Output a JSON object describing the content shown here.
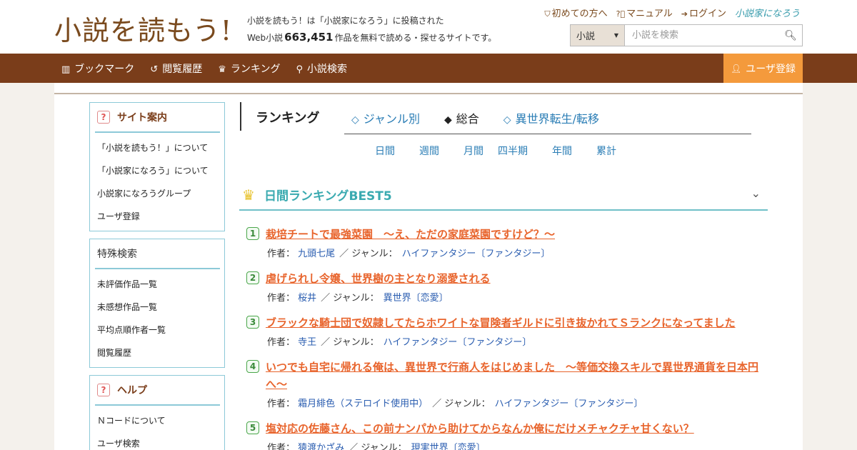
{
  "header": {
    "logo_text": "小説を読もう!",
    "tagline_line1": "小説を読もう！は「小説家になろう」に投稿された",
    "tagline_prefix": "Web小説",
    "work_count": "663,451",
    "tagline_suffix": "作品を無料で読める・探せるサイトです。",
    "toplinks": {
      "first_time": "初めての方へ",
      "manual": "マニュアル",
      "login": "ログイン",
      "narou_logo": "小説家になろう"
    },
    "search": {
      "category": "小説",
      "placeholder": "小説を検索"
    }
  },
  "navbar": {
    "items": [
      {
        "label": "ブックマーク",
        "icon": "bookmark-icon"
      },
      {
        "label": "閲覧履歴",
        "icon": "history-icon"
      },
      {
        "label": "ランキング",
        "icon": "crown-icon"
      },
      {
        "label": "小説検索",
        "icon": "search-icon"
      }
    ],
    "register_label": "ユーザ登録"
  },
  "sidebar": {
    "site_guide": {
      "title": "サイト案内",
      "items": [
        "「小説を読もう！」について",
        "「小説家になろう」について",
        "小説家になろうグループ",
        "ユーザ登録"
      ]
    },
    "special_search": {
      "title": "特殊検索",
      "items": [
        "未評価作品一覧",
        "未感想作品一覧",
        "平均点順作者一覧",
        "閲覧履歴"
      ]
    },
    "help": {
      "title": "ヘルプ",
      "items": [
        "Ｎコードについて",
        "ユーザ検索"
      ]
    }
  },
  "ranking": {
    "title": "ランキング",
    "tabs": [
      {
        "label": "ジャンル別",
        "marker": "◇"
      },
      {
        "label": "総合",
        "marker": "◆"
      },
      {
        "label": "異世界転生/転移",
        "marker": "◇"
      }
    ],
    "periods": [
      "日間",
      "週間",
      "月間",
      "四半期",
      "年間",
      "累計"
    ],
    "best_title": "日間ランキングBEST5",
    "author_label": "作者：",
    "genre_label": "／ ジャンル：",
    "novels": [
      {
        "rank": "1",
        "title": "栽培チートで最強菜園　～え、ただの家庭菜園ですけど？～",
        "author": "九頭七尾",
        "genre": "ハイファンタジー〔ファンタジー〕"
      },
      {
        "rank": "2",
        "title": "虐げられし令嬢、世界樹の主となり溺愛される",
        "author": "桜井",
        "genre": "異世界〔恋愛〕"
      },
      {
        "rank": "3",
        "title": "ブラックな騎士団で奴隷してたらホワイトな冒険者ギルドに引き抜かれてＳランクになってました",
        "author": "寺王",
        "genre": "ハイファンタジー〔ファンタジー〕"
      },
      {
        "rank": "4",
        "title": "いつでも自宅に帰れる俺は、異世界で行商人をはじめました　～等価交換スキルで異世界通貨を日本円へ～",
        "author": "霜月緋色（ステロイド使用中）",
        "genre": "ハイファンタジー〔ファンタジー〕"
      },
      {
        "rank": "5",
        "title": "塩対応の佐藤さん、この前ナンパから助けてからなんか俺にだけメチャクチャ甘くない？",
        "author": "猿渡かざみ",
        "genre": "現実世界〔恋愛〕"
      }
    ]
  },
  "colors": {
    "brand_brown": "#7a3d1a",
    "accent_orange": "#f49a3c",
    "link_blue": "#2a7db5",
    "title_orange": "#e8642c",
    "teal": "#3aaab0"
  }
}
